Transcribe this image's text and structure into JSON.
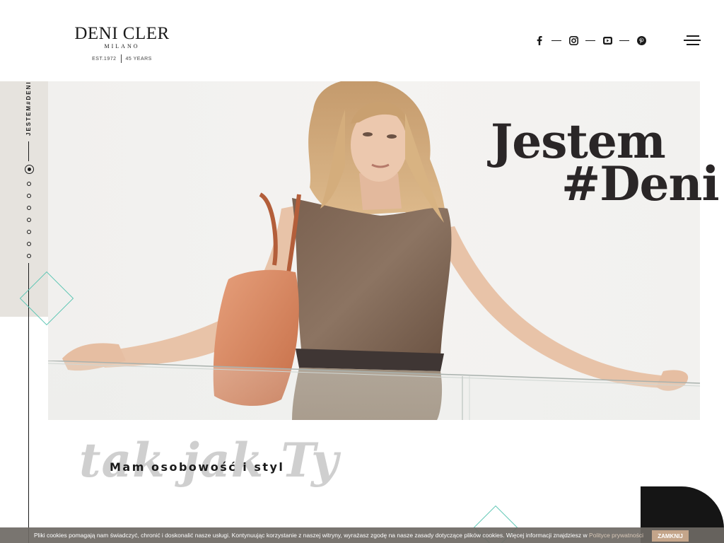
{
  "brand": {
    "name": "DENI CLER",
    "city": "MILANO",
    "established": "EST.1972",
    "years": "45 YEARS"
  },
  "social": [
    {
      "icon": "facebook-icon",
      "label": "f"
    },
    {
      "icon": "instagram-icon"
    },
    {
      "icon": "youtube-icon"
    },
    {
      "icon": "pinterest-icon"
    }
  ],
  "sidebar": {
    "vertical_text": "JESTEM#DENI",
    "slides_count": 8,
    "active_slide": 1
  },
  "hero": {
    "title_line1": "Jestem",
    "title_line2": "#Deni"
  },
  "section": {
    "script_text": "tak jak Ty",
    "tagline": "Mam osobowość i styl"
  },
  "cookie_bar": {
    "text": "Pliki cookies pomagają nam świadczyć, chronić i doskonalić nasze usługi. Kontynuując korzystanie z naszej witryny, wyrażasz zgodę na nasze zasady dotyczące plików cookies. Więcej informacji znajdziesz w ",
    "link_text": "Polityce prywatności",
    "button_label": "ZAMKNIJ"
  },
  "colors": {
    "accent": "#5fc7b5",
    "text": "#1a1a1a",
    "panel": "#e6e3de",
    "cookie_button": "#c4a58a"
  }
}
